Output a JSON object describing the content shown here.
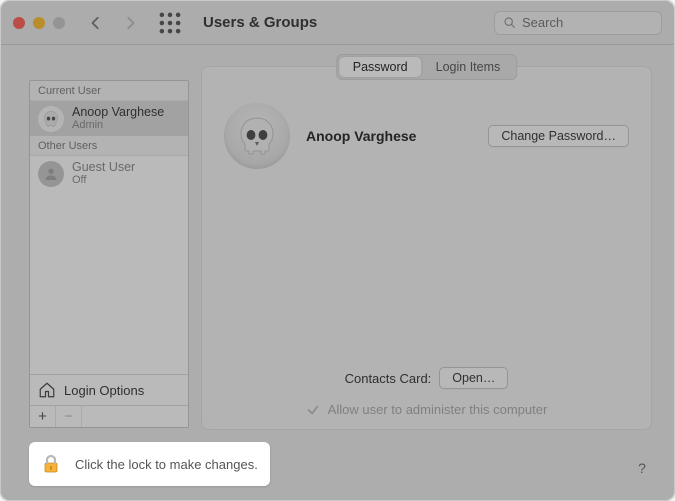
{
  "window": {
    "title": "Users & Groups",
    "search_placeholder": "Search"
  },
  "sidebar": {
    "current_user_header": "Current User",
    "other_users_header": "Other Users",
    "current_user": {
      "name": "Anoop Varghese",
      "role": "Admin"
    },
    "guest_user": {
      "name": "Guest User",
      "status": "Off"
    },
    "login_options": "Login Options",
    "plus": "+",
    "minus": "−"
  },
  "tabs": {
    "password": "Password",
    "login_items": "Login Items"
  },
  "main": {
    "user_name": "Anoop Varghese",
    "change_password": "Change Password…",
    "contacts_label": "Contacts Card:",
    "open_label": "Open…",
    "admin_label": "Allow user to administer this computer"
  },
  "lock": {
    "message": "Click the lock to make changes."
  },
  "help": {
    "label": "?"
  }
}
